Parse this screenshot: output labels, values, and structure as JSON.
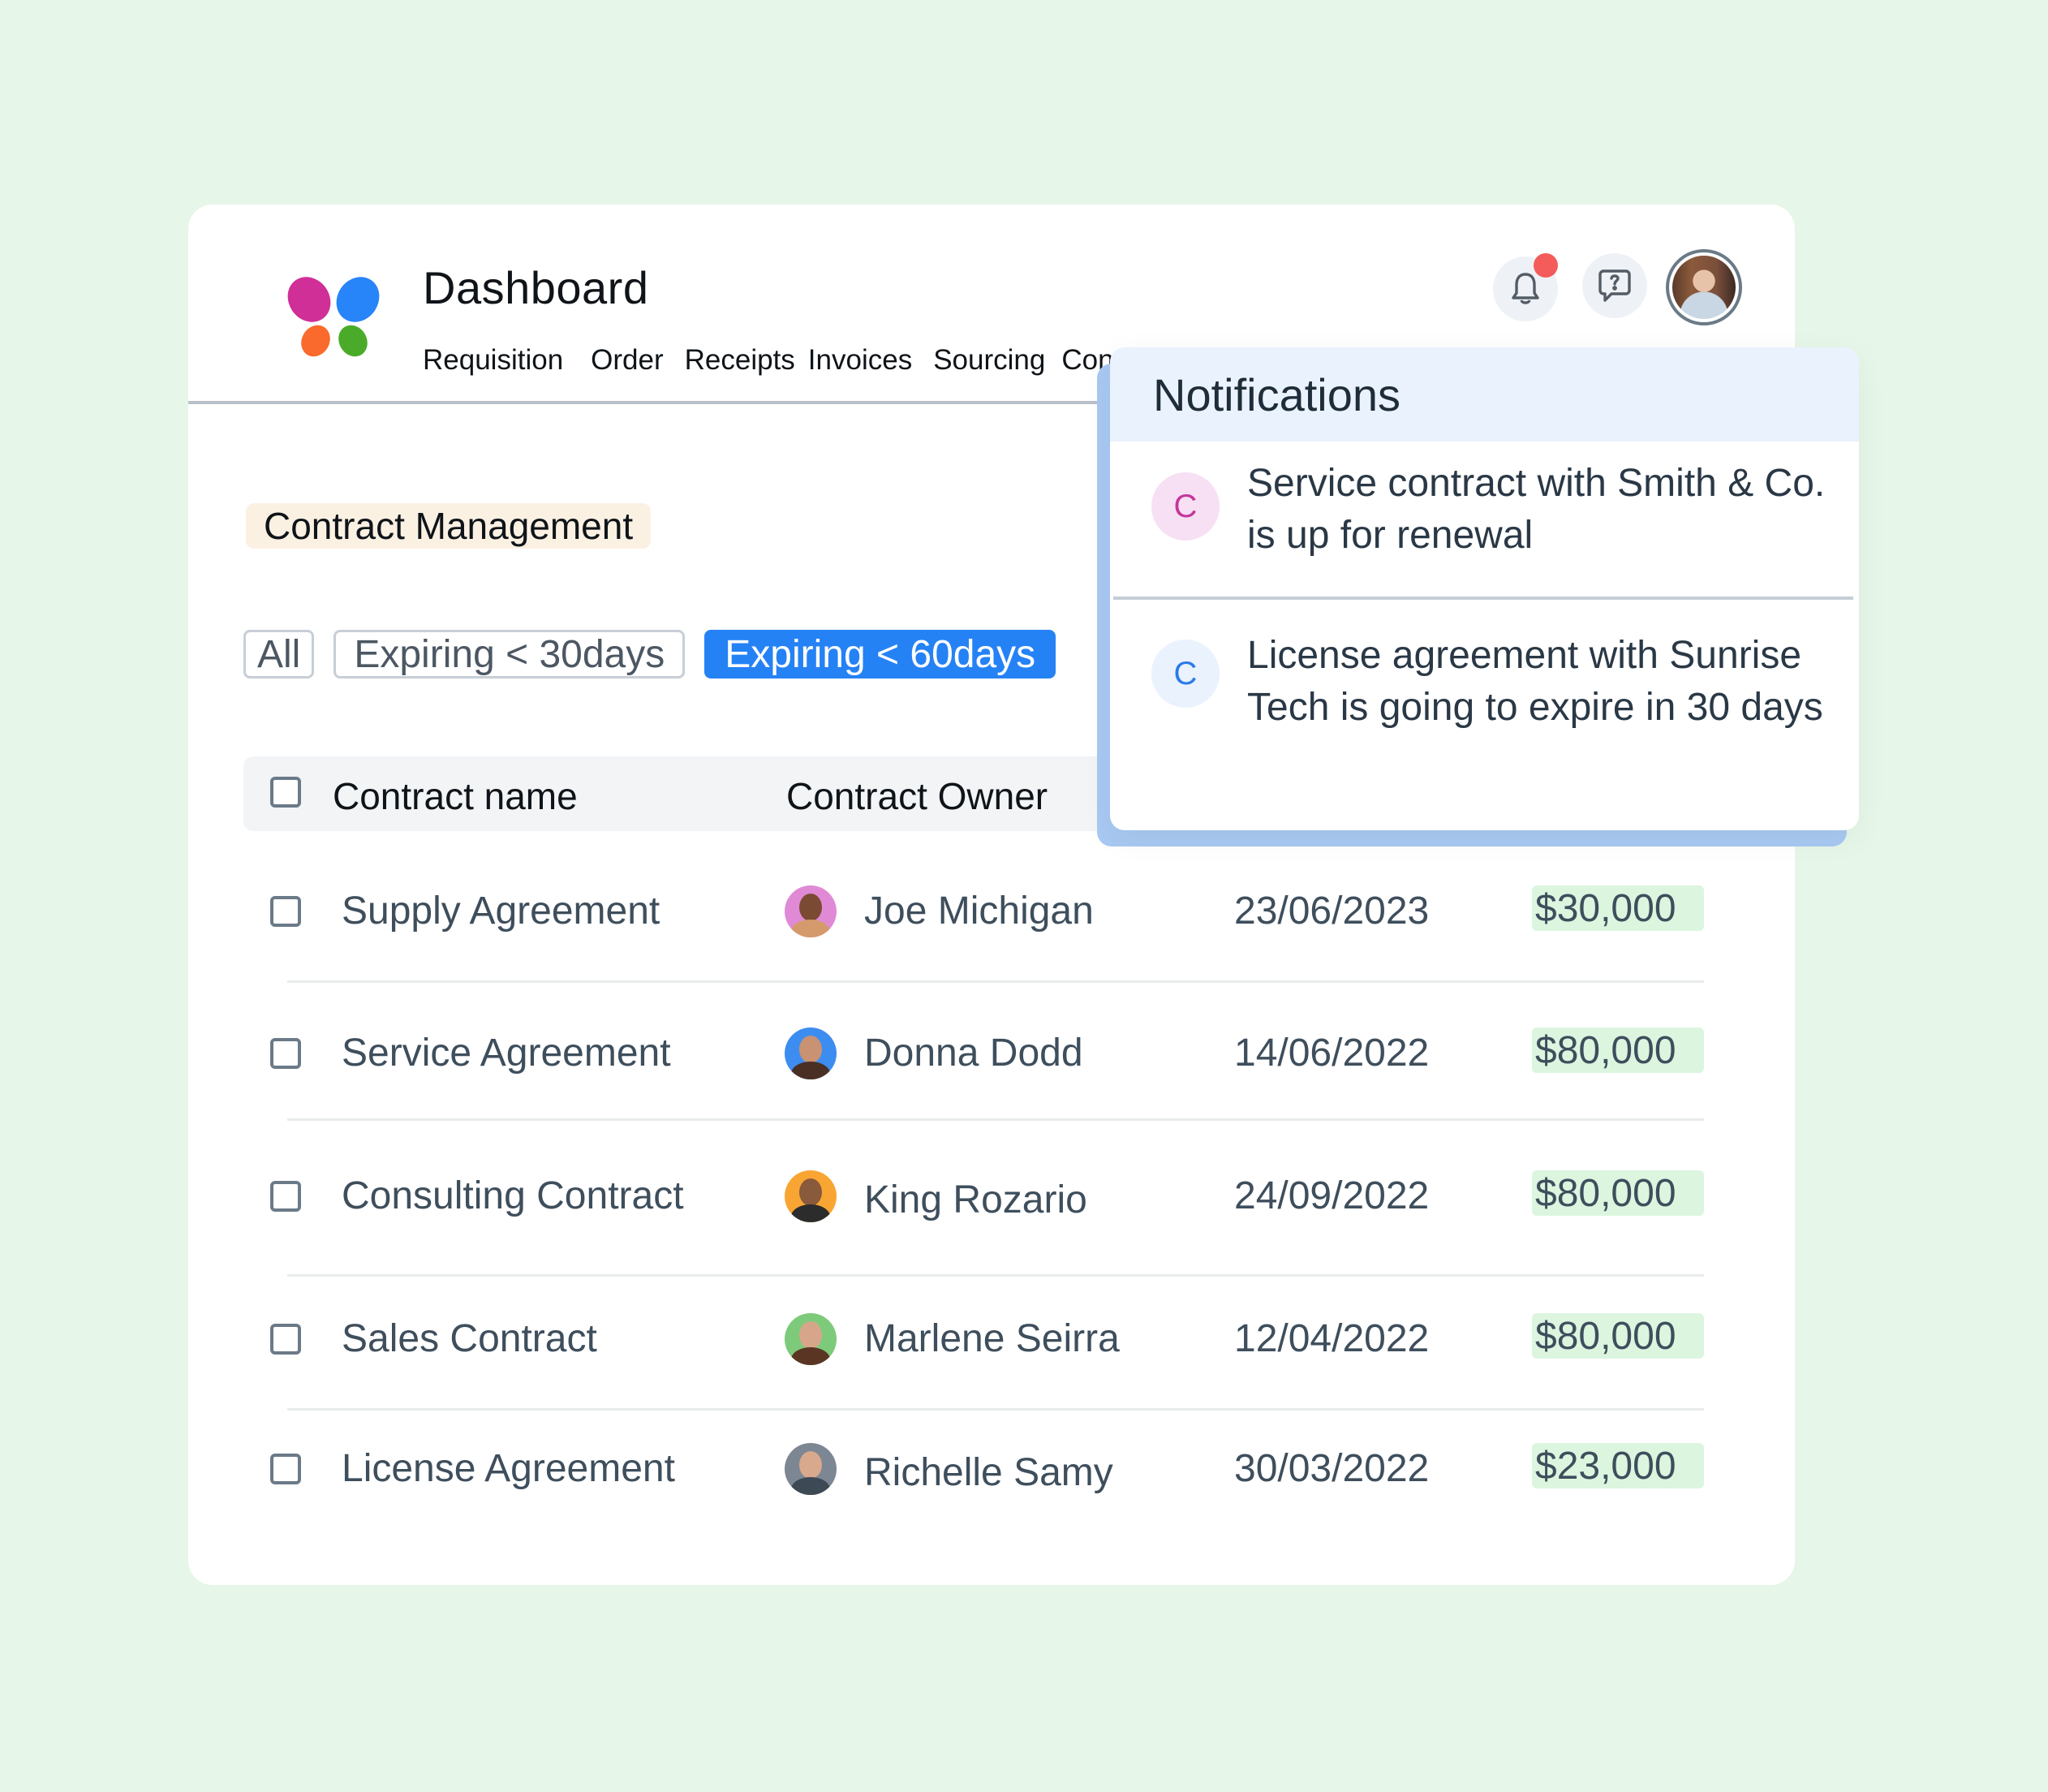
{
  "header": {
    "title": "Dashboard",
    "nav": [
      "Requisition",
      "Order",
      "Receipts",
      "Invoices",
      "Sourcing",
      "Contracts"
    ],
    "icons": {
      "notifications": "bell-icon",
      "help": "chat-help-icon",
      "profile": "user-avatar"
    },
    "notification_badge_color": "#f45b5b"
  },
  "logo": {
    "colors": [
      "#d02f97",
      "#2884f9",
      "#fa6a2c",
      "#4aab2a"
    ]
  },
  "section": {
    "label": "Contract Management"
  },
  "filters": {
    "items": [
      "All",
      "Expiring < 30days",
      "Expiring < 60days"
    ],
    "active": "Expiring < 60days"
  },
  "table": {
    "columns": [
      "Contract name",
      "Contract Owner"
    ],
    "rows": [
      {
        "name": "Supply Agreement",
        "owner": "Joe Michigan",
        "date": "23/06/2023",
        "value": "$30,000",
        "avatar_bg": "#e08ad6"
      },
      {
        "name": "Service Agreement",
        "owner": "Donna Dodd",
        "date": "14/06/2022",
        "value": "$80,000",
        "avatar_bg": "#3d8df0"
      },
      {
        "name": "Consulting Contract",
        "owner": "King Rozario",
        "date": "24/09/2022",
        "value": "$80,000",
        "avatar_bg": "#f9a533"
      },
      {
        "name": "Sales Contract",
        "owner": "Marlene Seirra",
        "date": "12/04/2022",
        "value": "$80,000",
        "avatar_bg": "#7dcb7a"
      },
      {
        "name": "License Agreement",
        "owner": "Richelle Samy",
        "date": "30/03/2022",
        "value": "$23,000",
        "avatar_bg": "#7c8793"
      }
    ]
  },
  "notifications": {
    "title": "Notifications",
    "items": [
      {
        "initial": "C",
        "text": "Service contract with Smith & Co. is up for renewal",
        "bg": "#f7e0f3",
        "fg": "#c4379d"
      },
      {
        "initial": "C",
        "text": "License agreement with Sunrise Tech is going to expire in 30 days",
        "bg": "#eaf2fd",
        "fg": "#2c7be5"
      }
    ]
  }
}
